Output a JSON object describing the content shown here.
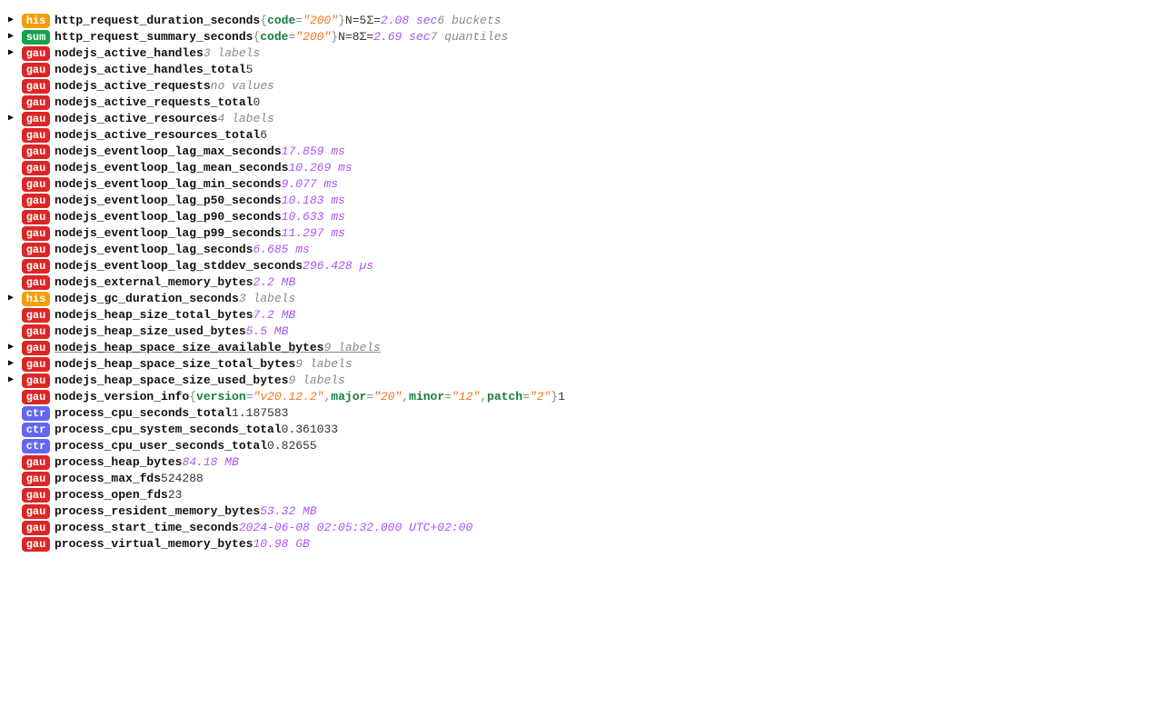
{
  "rows": [
    {
      "expand": true,
      "tag": "his",
      "name": "http_request_duration_seconds",
      "labels": [
        {
          "k": "code",
          "v": "\"200\""
        }
      ],
      "parts": [
        {
          "cls": "stat",
          "t": " N=5 "
        },
        {
          "cls": "sigma",
          "t": "Σ="
        },
        {
          "cls": "dur",
          "t": "2.08 sec "
        },
        {
          "cls": "muted",
          "t": "6 buckets"
        }
      ]
    },
    {
      "expand": true,
      "tag": "sum",
      "name": "http_request_summary_seconds",
      "labels": [
        {
          "k": "code",
          "v": "\"200\""
        }
      ],
      "parts": [
        {
          "cls": "stat",
          "t": " N=8 "
        },
        {
          "cls": "sigma",
          "t": "Σ="
        },
        {
          "cls": "dur",
          "t": "2.69 sec "
        },
        {
          "cls": "muted",
          "t": "7 quantiles"
        }
      ]
    },
    {
      "expand": true,
      "tag": "gau",
      "name": "nodejs_active_handles",
      "parts": [
        {
          "cls": "muted",
          "t": " 3 labels"
        }
      ]
    },
    {
      "expand": false,
      "tag": "gau",
      "name": "nodejs_active_handles_total",
      "parts": [
        {
          "cls": "plain",
          "t": " 5"
        }
      ]
    },
    {
      "expand": false,
      "tag": "gau",
      "name": "nodejs_active_requests",
      "parts": [
        {
          "cls": "muted",
          "t": " no values"
        }
      ]
    },
    {
      "expand": false,
      "tag": "gau",
      "name": "nodejs_active_requests_total",
      "parts": [
        {
          "cls": "plain",
          "t": " 0"
        }
      ]
    },
    {
      "expand": true,
      "tag": "gau",
      "name": "nodejs_active_resources",
      "parts": [
        {
          "cls": "muted",
          "t": " 4 labels"
        }
      ]
    },
    {
      "expand": false,
      "tag": "gau",
      "name": "nodejs_active_resources_total",
      "parts": [
        {
          "cls": "plain",
          "t": " 6"
        }
      ]
    },
    {
      "expand": false,
      "tag": "gau",
      "name": "nodejs_eventloop_lag_max_seconds",
      "parts": [
        {
          "cls": "dur",
          "t": " 17.859 ms"
        }
      ]
    },
    {
      "expand": false,
      "tag": "gau",
      "name": "nodejs_eventloop_lag_mean_seconds",
      "parts": [
        {
          "cls": "dur",
          "t": " 10.269 ms"
        }
      ]
    },
    {
      "expand": false,
      "tag": "gau",
      "name": "nodejs_eventloop_lag_min_seconds",
      "parts": [
        {
          "cls": "dur",
          "t": " 9.077 ms"
        }
      ]
    },
    {
      "expand": false,
      "tag": "gau",
      "name": "nodejs_eventloop_lag_p50_seconds",
      "parts": [
        {
          "cls": "dur",
          "t": " 10.183 ms"
        }
      ]
    },
    {
      "expand": false,
      "tag": "gau",
      "name": "nodejs_eventloop_lag_p90_seconds",
      "parts": [
        {
          "cls": "dur",
          "t": " 10.633 ms"
        }
      ]
    },
    {
      "expand": false,
      "tag": "gau",
      "name": "nodejs_eventloop_lag_p99_seconds",
      "parts": [
        {
          "cls": "dur",
          "t": " 11.297 ms"
        }
      ]
    },
    {
      "expand": false,
      "tag": "gau",
      "name": "nodejs_eventloop_lag_seconds",
      "parts": [
        {
          "cls": "dur",
          "t": " 6.685 ms"
        }
      ]
    },
    {
      "expand": false,
      "tag": "gau",
      "name": "nodejs_eventloop_lag_stddev_seconds",
      "parts": [
        {
          "cls": "dur",
          "t": " 296.428 µs"
        }
      ]
    },
    {
      "expand": false,
      "tag": "gau",
      "name": "nodejs_external_memory_bytes",
      "parts": [
        {
          "cls": "dur",
          "t": " 2.2 MB"
        }
      ]
    },
    {
      "expand": true,
      "tag": "his",
      "name": "nodejs_gc_duration_seconds",
      "parts": [
        {
          "cls": "muted",
          "t": " 3 labels"
        }
      ]
    },
    {
      "expand": false,
      "tag": "gau",
      "name": "nodejs_heap_size_total_bytes",
      "parts": [
        {
          "cls": "dur",
          "t": " 7.2 MB"
        }
      ]
    },
    {
      "expand": false,
      "tag": "gau",
      "name": "nodejs_heap_size_used_bytes",
      "parts": [
        {
          "cls": "dur",
          "t": " 5.5 MB"
        }
      ]
    },
    {
      "expand": true,
      "tag": "gau",
      "name": "nodejs_heap_space_size_available_bytes",
      "hi": true,
      "parts": [
        {
          "cls": "muted hl",
          "t": " 9 labels"
        }
      ]
    },
    {
      "expand": true,
      "tag": "gau",
      "name": "nodejs_heap_space_size_total_bytes",
      "parts": [
        {
          "cls": "muted",
          "t": " 9 labels"
        }
      ]
    },
    {
      "expand": true,
      "tag": "gau",
      "name": "nodejs_heap_space_size_used_bytes",
      "parts": [
        {
          "cls": "muted",
          "t": " 9 labels"
        }
      ]
    },
    {
      "expand": false,
      "tag": "gau",
      "name": "nodejs_version_info",
      "labels": [
        {
          "k": "version",
          "v": "\"v20.12.2\"",
          "comma": true
        },
        {
          "k": "major",
          "v": "\"20\"",
          "comma": true
        },
        {
          "k": "minor",
          "v": "\"12\"",
          "comma": true
        },
        {
          "k": "patch",
          "v": "\"2\""
        }
      ],
      "parts": [
        {
          "cls": "plain",
          "t": " 1"
        }
      ]
    },
    {
      "expand": false,
      "tag": "ctr",
      "name": "process_cpu_seconds_total",
      "parts": [
        {
          "cls": "plain",
          "t": " 1.187583"
        }
      ]
    },
    {
      "expand": false,
      "tag": "ctr",
      "name": "process_cpu_system_seconds_total",
      "parts": [
        {
          "cls": "plain",
          "t": " 0.361033"
        }
      ]
    },
    {
      "expand": false,
      "tag": "ctr",
      "name": "process_cpu_user_seconds_total",
      "parts": [
        {
          "cls": "plain",
          "t": " 0.82655"
        }
      ]
    },
    {
      "expand": false,
      "tag": "gau",
      "name": "process_heap_bytes",
      "parts": [
        {
          "cls": "dur",
          "t": " 84.18 MB"
        }
      ]
    },
    {
      "expand": false,
      "tag": "gau",
      "name": "process_max_fds",
      "parts": [
        {
          "cls": "plain",
          "t": " 524288"
        }
      ]
    },
    {
      "expand": false,
      "tag": "gau",
      "name": "process_open_fds",
      "parts": [
        {
          "cls": "plain",
          "t": " 23"
        }
      ]
    },
    {
      "expand": false,
      "tag": "gau",
      "name": "process_resident_memory_bytes",
      "parts": [
        {
          "cls": "dur",
          "t": " 53.32 MB"
        }
      ]
    },
    {
      "expand": false,
      "tag": "gau",
      "name": "process_start_time_seconds",
      "parts": [
        {
          "cls": "dur",
          "t": " 2024-06-08 02:05:32.000 UTC+02:00"
        }
      ]
    },
    {
      "expand": false,
      "tag": "gau",
      "name": "process_virtual_memory_bytes",
      "parts": [
        {
          "cls": "dur",
          "t": " 10.98 GB"
        }
      ]
    }
  ]
}
